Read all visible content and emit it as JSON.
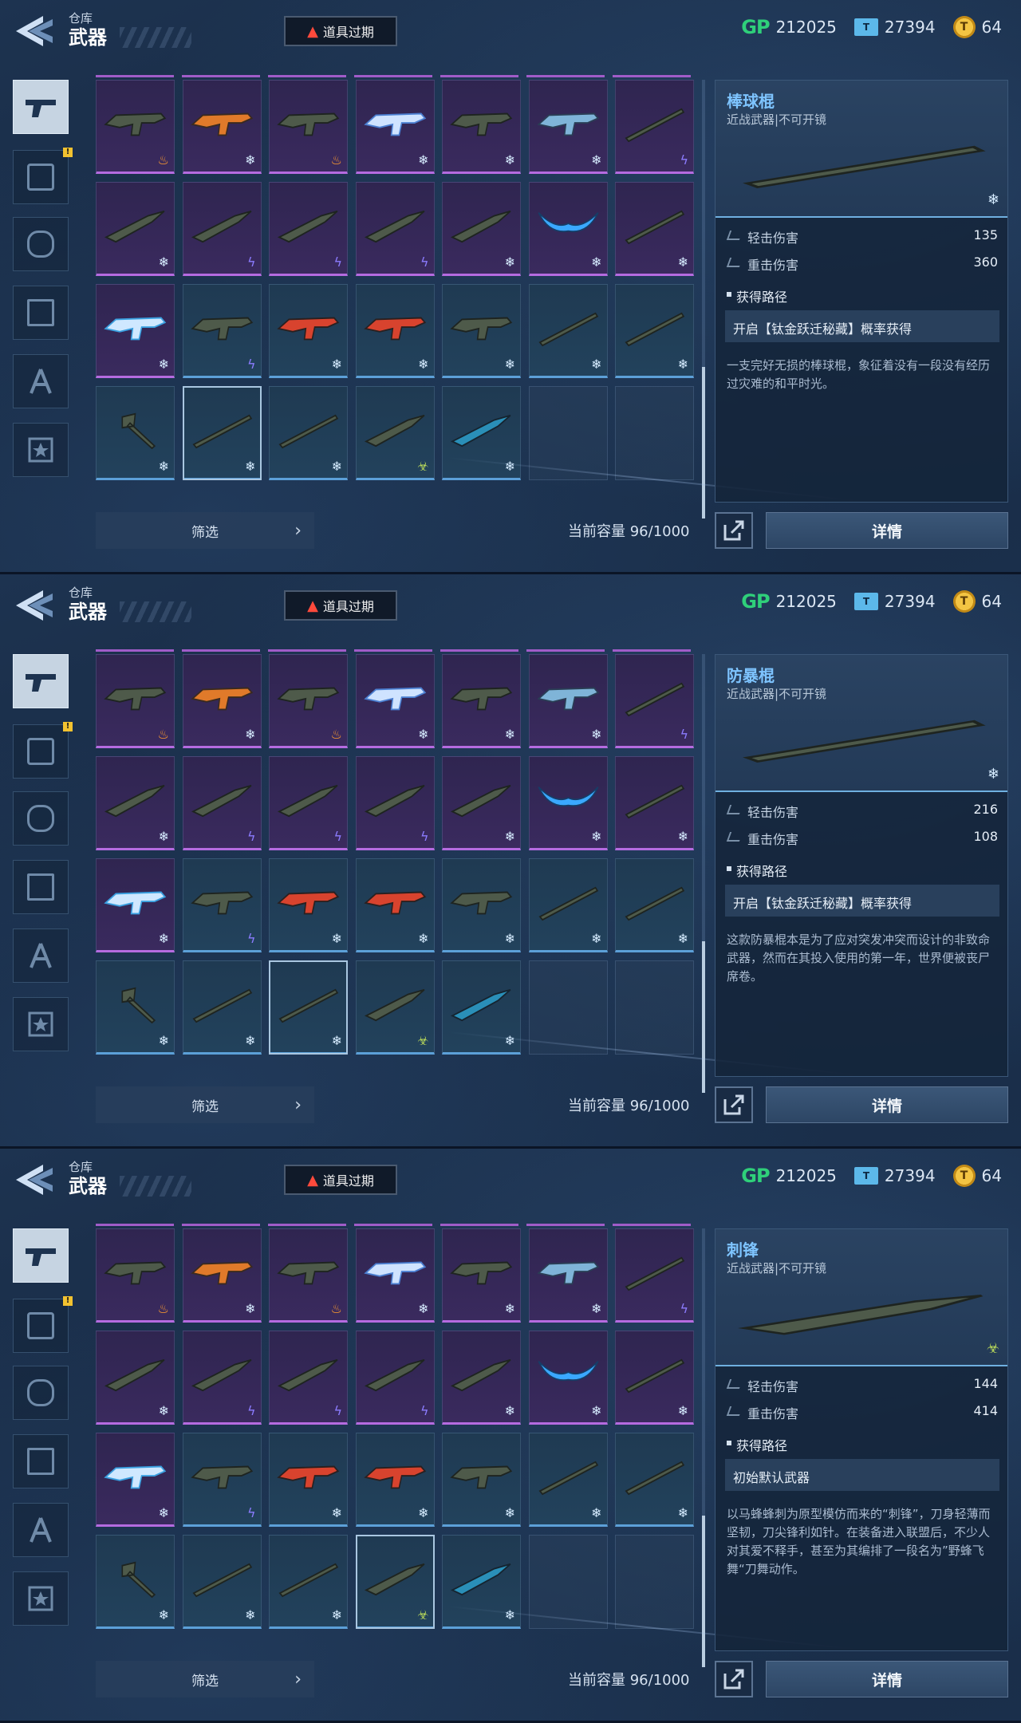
{
  "header": {
    "breadcrumb_parent": "仓库",
    "breadcrumb_current": "武器",
    "expire_label": "道具过期",
    "currencies": [
      {
        "icon": "gp-icon",
        "label": "GP",
        "value": "212025"
      },
      {
        "icon": "ticket-icon",
        "value": "27394"
      },
      {
        "icon": "coin-icon",
        "value": "64"
      }
    ]
  },
  "categories": [
    {
      "name": "weapon",
      "icon": "pistol-icon",
      "active": true
    },
    {
      "name": "armor",
      "icon": "armor-icon",
      "badge": "!"
    },
    {
      "name": "helmet",
      "icon": "helmet-icon"
    },
    {
      "name": "gear",
      "icon": "gear-icon"
    },
    {
      "name": "outfit",
      "icon": "outfit-icon"
    },
    {
      "name": "badge",
      "icon": "star-badge-icon"
    }
  ],
  "grid": {
    "rows": [
      [
        {
          "rarity": "purple",
          "weapon": "rifle",
          "element": "fire"
        },
        {
          "rarity": "purple",
          "weapon": "orange-rifle",
          "element": "ice"
        },
        {
          "rarity": "purple",
          "weapon": "smg",
          "element": "fire"
        },
        {
          "rarity": "purple",
          "weapon": "blue-rifle",
          "element": "ice"
        },
        {
          "rarity": "purple",
          "weapon": "shotgun",
          "element": "ice"
        },
        {
          "rarity": "purple",
          "weapon": "camo-rifle",
          "element": "ice"
        },
        {
          "rarity": "purple",
          "weapon": "spiked-bat",
          "element": "bolt"
        }
      ],
      [
        {
          "rarity": "purple",
          "weapon": "machete",
          "element": "ice"
        },
        {
          "rarity": "purple",
          "weapon": "knife",
          "element": "bolt"
        },
        {
          "rarity": "purple",
          "weapon": "knife",
          "element": "bolt"
        },
        {
          "rarity": "purple",
          "weapon": "knife",
          "element": "bolt"
        },
        {
          "rarity": "purple",
          "weapon": "knife",
          "element": "ice"
        },
        {
          "rarity": "purple",
          "weapon": "wing-blade",
          "element": "ice"
        },
        {
          "rarity": "purple",
          "weapon": "chain-bat",
          "element": "ice"
        }
      ],
      [
        {
          "rarity": "purple",
          "weapon": "crossbow",
          "element": "ice"
        },
        {
          "rarity": "blue",
          "weapon": "lmg",
          "element": "bolt"
        },
        {
          "rarity": "blue",
          "weapon": "red-smg",
          "element": "ice"
        },
        {
          "rarity": "blue",
          "weapon": "red-smg",
          "element": "ice"
        },
        {
          "rarity": "blue",
          "weapon": "pistol",
          "element": "ice"
        },
        {
          "rarity": "blue",
          "weapon": "staff",
          "element": "ice"
        },
        {
          "rarity": "blue",
          "weapon": "staff",
          "element": "ice"
        }
      ],
      [
        {
          "rarity": "blue",
          "weapon": "axe",
          "element": "ice"
        },
        {
          "rarity": "blue",
          "weapon": "bat",
          "element": "ice"
        },
        {
          "rarity": "blue",
          "weapon": "baton",
          "element": "ice"
        },
        {
          "rarity": "blue",
          "weapon": "dagger",
          "element": "bio"
        },
        {
          "rarity": "blue",
          "weapon": "blue-knife",
          "element": "ice"
        },
        {
          "rarity": "empty"
        },
        {
          "rarity": "empty"
        }
      ]
    ]
  },
  "footer": {
    "filter_label": "筛选",
    "capacity_label": "当前容量",
    "capacity_value": "96/1000",
    "detail_label": "详情"
  },
  "panels": [
    {
      "selected": [
        3,
        1
      ],
      "item": {
        "name": "棒球棍",
        "subtitle": "近战武器|不可开镜",
        "element": "ice",
        "stats": [
          {
            "label": "轻击伤害",
            "value": "135"
          },
          {
            "label": "重击伤害",
            "value": "360"
          }
        ],
        "route_title": "获得路径",
        "route": "开启【钛金跃迁秘藏】概率获得",
        "description": "一支完好无损的棒球棍，象征着没有一段没有经历过灾难的和平时光。"
      }
    },
    {
      "selected": [
        3,
        2
      ],
      "item": {
        "name": "防暴棍",
        "subtitle": "近战武器|不可开镜",
        "element": "ice",
        "stats": [
          {
            "label": "轻击伤害",
            "value": "216"
          },
          {
            "label": "重击伤害",
            "value": "108"
          }
        ],
        "route_title": "获得路径",
        "route": "开启【钛金跃迁秘藏】概率获得",
        "description": "这款防暴棍本是为了应对突发冲突而设计的非致命武器，然而在其投入使用的第一年，世界便被丧尸席卷。"
      }
    },
    {
      "selected": [
        3,
        3
      ],
      "item": {
        "name": "刺锋",
        "subtitle": "近战武器|不可开镜",
        "element": "bio",
        "stats": [
          {
            "label": "轻击伤害",
            "value": "144"
          },
          {
            "label": "重击伤害",
            "value": "414"
          }
        ],
        "route_title": "获得路径",
        "route": "初始默认武器",
        "description": "以马蜂蜂刺为原型模仿而来的“刺锋”，刀身轻薄而坚韧，刀尖锋利如针。在装备进入联盟后，不少人对其爱不释手，甚至为其编排了一段名为”野蜂飞舞“刀舞动作。"
      }
    }
  ]
}
